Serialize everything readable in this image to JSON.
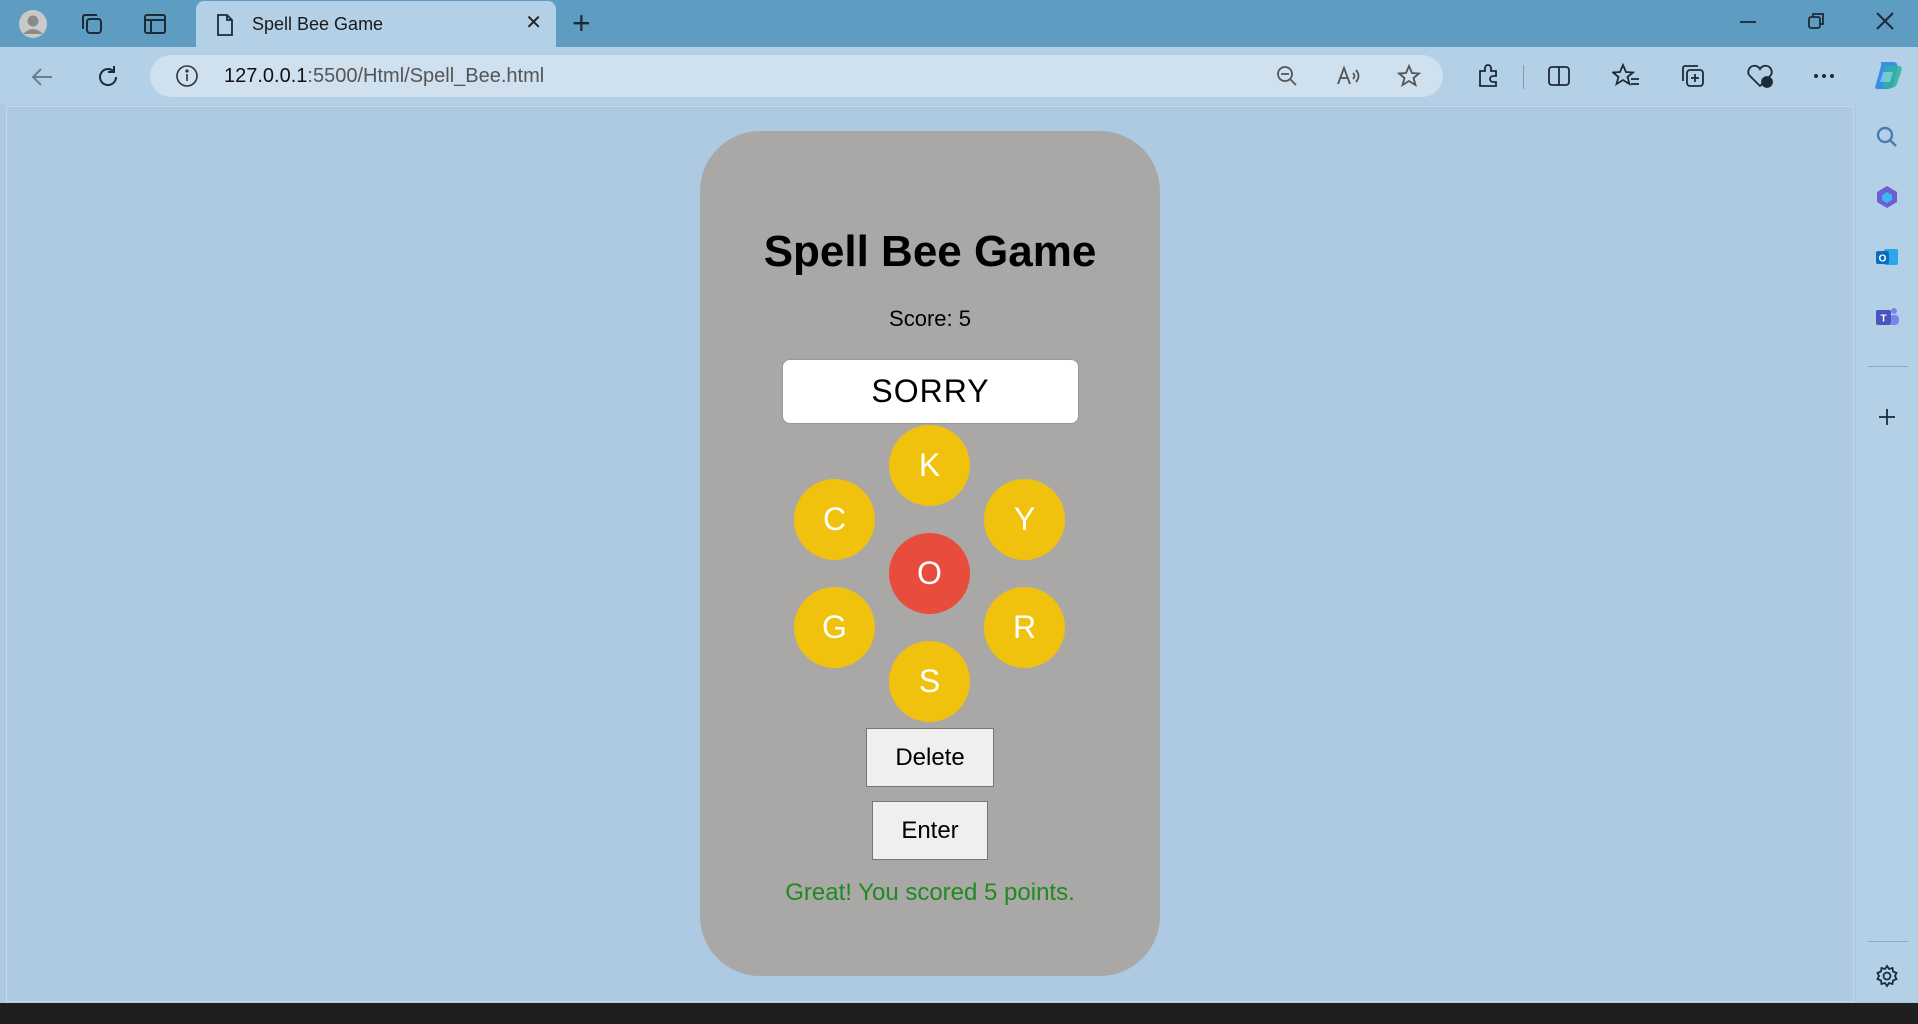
{
  "browser": {
    "tab_title": "Spell Bee Game",
    "url_host": "127.0.0.1",
    "url_rest": ":5500/Html/Spell_Bee.html"
  },
  "game": {
    "title": "Spell Bee Game",
    "score_label": "Score: 5",
    "current_word": "SORRY",
    "letters": {
      "top": "K",
      "upper_left": "C",
      "upper_right": "Y",
      "center": "O",
      "lower_left": "G",
      "lower_right": "R",
      "bottom": "S"
    },
    "delete_label": "Delete",
    "enter_label": "Enter",
    "message": "Great! You scored 5 points."
  },
  "colors": {
    "outer_letter": "#f0c20d",
    "center_letter": "#e84c3d",
    "card_bg": "#aaa8a6",
    "message": "#1f8a1f"
  }
}
